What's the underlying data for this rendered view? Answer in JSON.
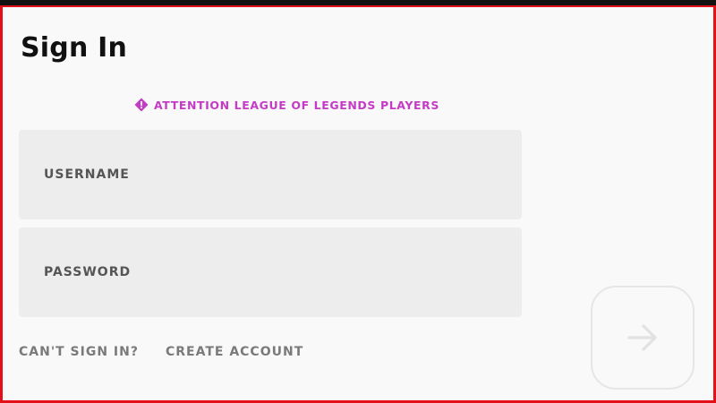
{
  "page": {
    "title": "Sign In"
  },
  "notice": {
    "icon": "alert-diamond-icon",
    "text": "ATTENTION LEAGUE OF LEGENDS PLAYERS",
    "color": "#c43bc6"
  },
  "form": {
    "username_placeholder": "USERNAME",
    "password_placeholder": "PASSWORD"
  },
  "links": {
    "cant_sign_in": "CAN'T SIGN IN?",
    "create_account": "CREATE ACCOUNT"
  },
  "submit": {
    "icon": "arrow-right-icon",
    "enabled": false
  },
  "theme": {
    "frame_border": "#e3101a",
    "background": "#f9f9f9",
    "field_background": "#ededed"
  }
}
